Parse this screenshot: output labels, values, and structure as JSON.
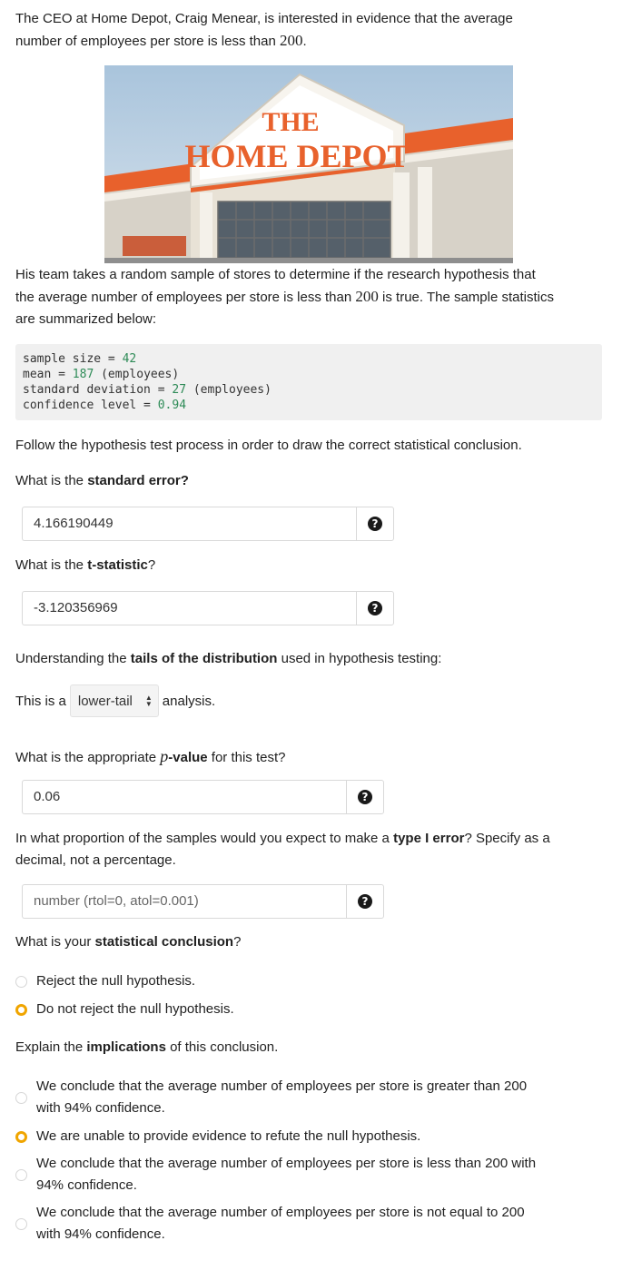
{
  "intro": {
    "line1": "The CEO at Home Depot, Craig Menear, is interested in evidence that the average",
    "line2_prefix": "number of employees per store is less than ",
    "line2_num": "200",
    "line2_suffix": "."
  },
  "store_image": {
    "sign_line1": "THE",
    "sign_line2": "HOME DEPOT"
  },
  "team": {
    "line1": "His team takes a random sample of stores to determine if the research hypothesis that",
    "line2_prefix": "the average number of employees per store is less than ",
    "line2_num": "200",
    "line2_suffix": " is true. The sample statistics",
    "line3": "are summarized below:"
  },
  "stats": [
    {
      "label": "sample size = ",
      "value": "42",
      "suffix": ""
    },
    {
      "label": "mean = ",
      "value": "187",
      "suffix": " (employees)"
    },
    {
      "label": "standard deviation = ",
      "value": "27",
      "suffix": " (employees)"
    },
    {
      "label": "confidence level = ",
      "value": "0.94",
      "suffix": ""
    }
  ],
  "follow": "Follow the hypothesis test process in order to draw the correct statistical conclusion.",
  "q_se": {
    "prefix": "What is the ",
    "bold": "standard error?",
    "suffix": "",
    "value": "4.166190449"
  },
  "q_t": {
    "prefix": "What is the ",
    "bold": "t-statistic",
    "suffix": "?",
    "value": "-3.120356969"
  },
  "tails": {
    "prefix": "Understanding the ",
    "bold": "tails of the distribution",
    "suffix": " used in hypothesis testing:",
    "sentence_prefix": "This is a",
    "selected": "lower-tail",
    "sentence_suffix": "analysis."
  },
  "q_p": {
    "prefix": "What is the appropriate ",
    "math": "p",
    "bold": "-value",
    "suffix": " for this test?",
    "value": "0.06"
  },
  "q_type1": {
    "prefix": "In what proportion of the samples would you expect to make a ",
    "bold": "type I error",
    "suffix": "? Specify as a",
    "line2": "decimal, not a percentage.",
    "placeholder": "number (rtol=0, atol=0.001)"
  },
  "q_conclusion": {
    "prefix": "What is your ",
    "bold": "statistical conclusion",
    "suffix": "?",
    "options": [
      {
        "label": "Reject the null hypothesis.",
        "checked": false
      },
      {
        "label": "Do not reject the null hypothesis.",
        "checked": true
      }
    ]
  },
  "q_implications": {
    "prefix": "Explain the ",
    "bold": "implications",
    "suffix": " of this conclusion.",
    "options": [
      {
        "line1": "We conclude that the average number of employees per store is greater than 200",
        "line2": "with 94% confidence.",
        "checked": false
      },
      {
        "line1": "We are unable to provide evidence to refute the null hypothesis.",
        "line2": "",
        "checked": true
      },
      {
        "line1": "We conclude that the average number of employees per store is less than 200 with",
        "line2": "94% confidence.",
        "checked": false
      },
      {
        "line1": "We conclude that the average number of employees per store is not equal to 200",
        "line2": "with 94% confidence.",
        "checked": false
      }
    ]
  },
  "colors": {
    "accent": "#f0a500",
    "code_bg": "#f0f0f0",
    "code_num": "#2e8b57"
  }
}
